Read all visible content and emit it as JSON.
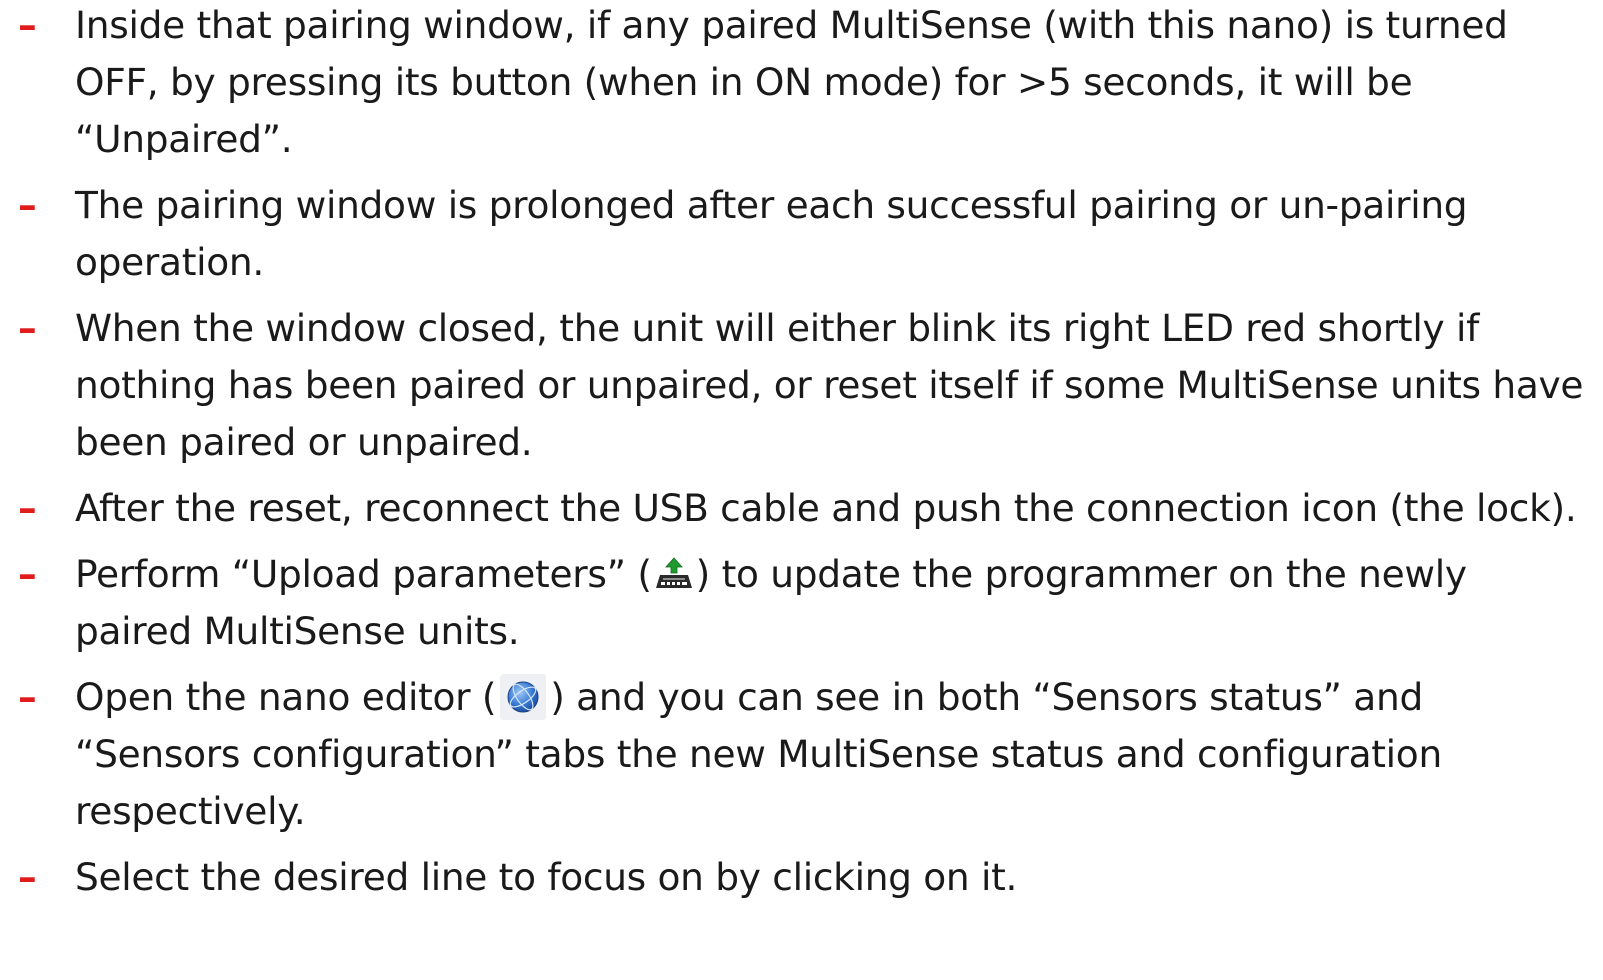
{
  "bullets": [
    {
      "text": "Inside that pairing window, if any paired MultiSense (with this nano) is turned OFF, by pressing its button (when in ON mode) for >5 seconds, it will be “Unpaired”."
    },
    {
      "text": "The pairing window is prolonged after each successful pairing or un-pairing operation."
    },
    {
      "text": "When the window closed, the unit will either blink its right LED red shortly if nothing has been paired or unpaired, or reset itself if some MultiSense units have been paired or unpaired."
    },
    {
      "text": "After the reset, reconnect the USB cable and push the connection icon (the lock)."
    },
    {
      "before": "Perform “Upload parameters” (",
      "icon": "upload-parameters-icon",
      "after": ") to update the programmer on the newly paired MultiSense units."
    },
    {
      "before": "Open the nano editor (",
      "icon": "nano-editor-icon",
      "after": ") and you can see in both “Sensors status” and “Sensors configuration” tabs the new MultiSense status and configuration respectively."
    },
    {
      "text": "Select the desired line to focus on by clicking on it."
    }
  ],
  "bullet_marker": "–",
  "colors": {
    "bullet_marker": "#e01c1c",
    "text": "#1a1a1a",
    "background": "#ffffff"
  }
}
